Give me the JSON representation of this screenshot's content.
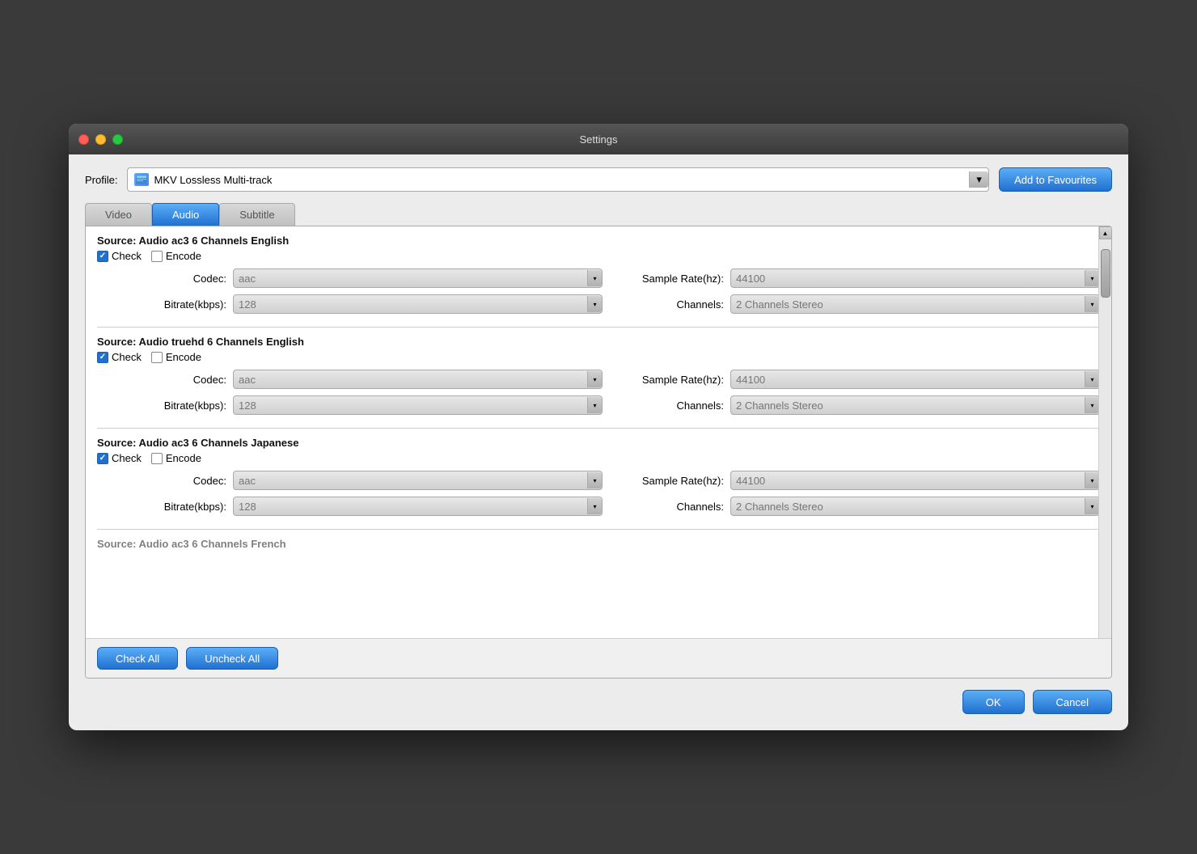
{
  "window": {
    "title": "Settings"
  },
  "profile": {
    "label": "Profile:",
    "icon": "🎬",
    "name": "MKV Lossless Multi-track",
    "arrow": "▼",
    "add_favourites": "Add to Favourites"
  },
  "tabs": [
    {
      "id": "video",
      "label": "Video",
      "active": false
    },
    {
      "id": "audio",
      "label": "Audio",
      "active": true
    },
    {
      "id": "subtitle",
      "label": "Subtitle",
      "active": false
    }
  ],
  "audio_sections": [
    {
      "source": "Source: Audio  ac3  6 Channels  English",
      "check_checked": true,
      "encode_checked": false,
      "codec": "aac",
      "sample_rate": "44100",
      "bitrate": "128",
      "channels": "2 Channels Stereo"
    },
    {
      "source": "Source: Audio  truehd  6 Channels  English",
      "check_checked": true,
      "encode_checked": false,
      "codec": "aac",
      "sample_rate": "44100",
      "bitrate": "128",
      "channels": "2 Channels Stereo"
    },
    {
      "source": "Source: Audio  ac3  6 Channels  Japanese",
      "check_checked": true,
      "encode_checked": false,
      "codec": "aac",
      "sample_rate": "44100",
      "bitrate": "128",
      "channels": "2 Channels Stereo"
    },
    {
      "source": "Source: Audio  ac3  6 Channels  French",
      "partial": true
    }
  ],
  "labels": {
    "check": "Check",
    "encode": "Encode",
    "codec": "Codec:",
    "sample_rate": "Sample Rate(hz):",
    "bitrate": "Bitrate(kbps):",
    "channels": "Channels:",
    "check_all": "Check All",
    "uncheck_all": "Uncheck All",
    "ok": "OK",
    "cancel": "Cancel"
  }
}
